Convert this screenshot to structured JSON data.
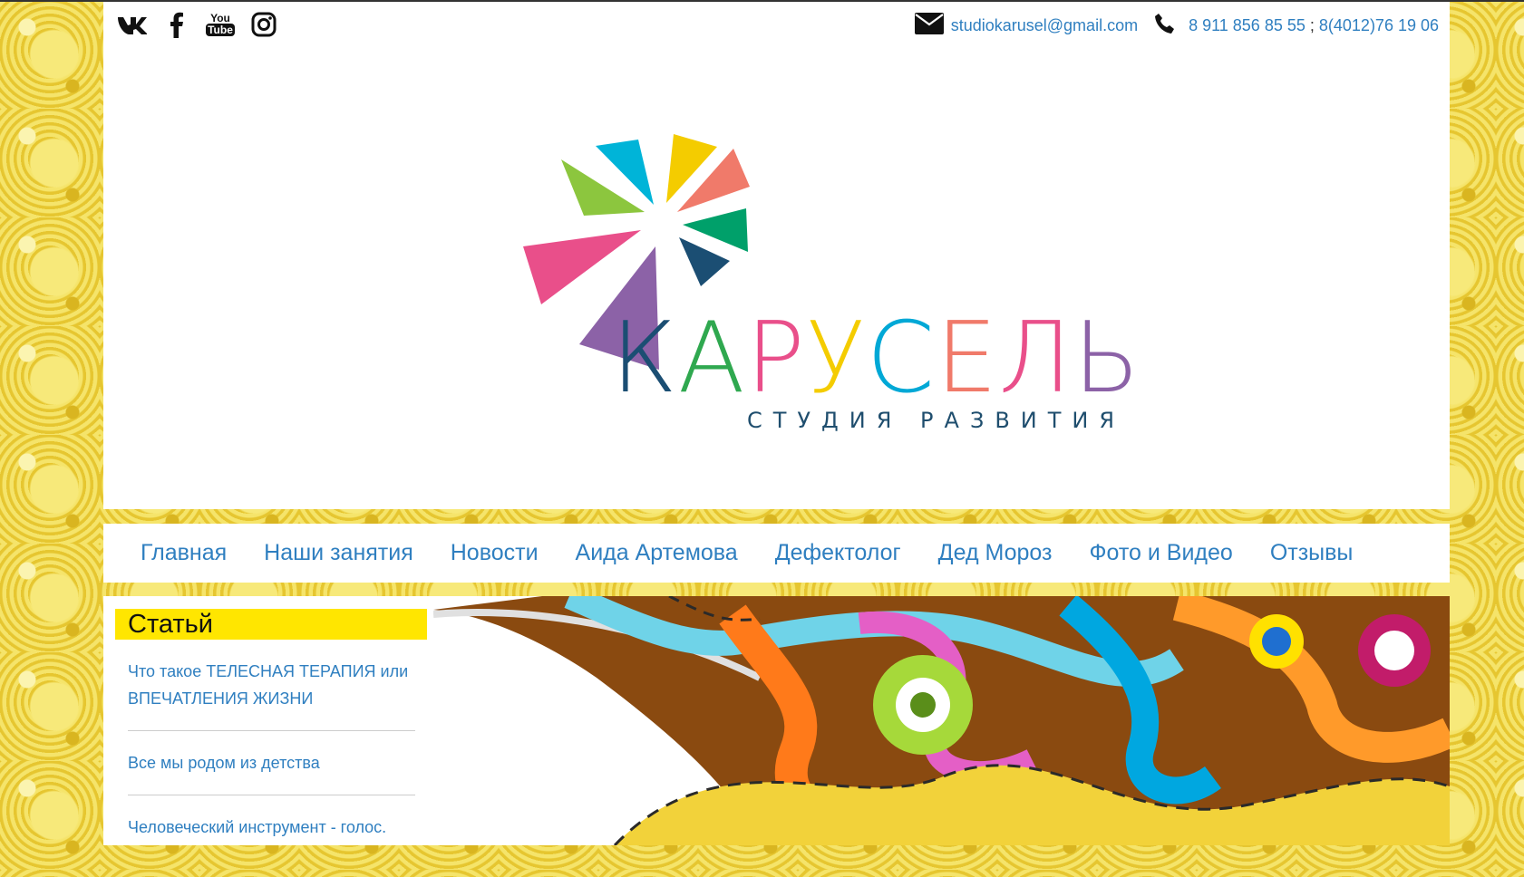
{
  "social": {
    "icons": [
      "vk-icon",
      "facebook-icon",
      "youtube-icon",
      "instagram-icon"
    ],
    "youtube_you": "You",
    "youtube_tube": "Tube"
  },
  "contacts": {
    "email": "studiokarusel@gmail.com",
    "phone1": "8 911 856 85 55",
    "separator": ";",
    "phone2": "8(4012)76 19 06"
  },
  "brand": {
    "letters": [
      "К",
      "А",
      "Р",
      "У",
      "С",
      "Е",
      "Л",
      "Ь"
    ],
    "colors": [
      "#1b4e73",
      "#2fa84f",
      "#e94f8a",
      "#f4cc00",
      "#00a8d6",
      "#f07a6a",
      "#e94f8a",
      "#8c62a7"
    ],
    "tagline": "СТУДИЯ РАЗВИТИЯ"
  },
  "nav": {
    "items": [
      "Главная",
      "Наши занятия",
      "Новости",
      "Аида Артемова",
      "Дефектолог",
      "Дед Мороз",
      "Фото и Видео",
      "Отзывы"
    ]
  },
  "sidebar": {
    "title": "Статьй",
    "articles": [
      "Что такое ТЕЛЕСНАЯ ТЕРАПИЯ или ВПЕЧАТЛЕНИЯ ЖИЗНИ",
      "Все мы родом из детства",
      "Человеческий инструмент - голос."
    ]
  },
  "colors": {
    "accent": "#2f7fc0",
    "title_bg": "#ffe600",
    "background_pattern": "#f2dd4a"
  }
}
